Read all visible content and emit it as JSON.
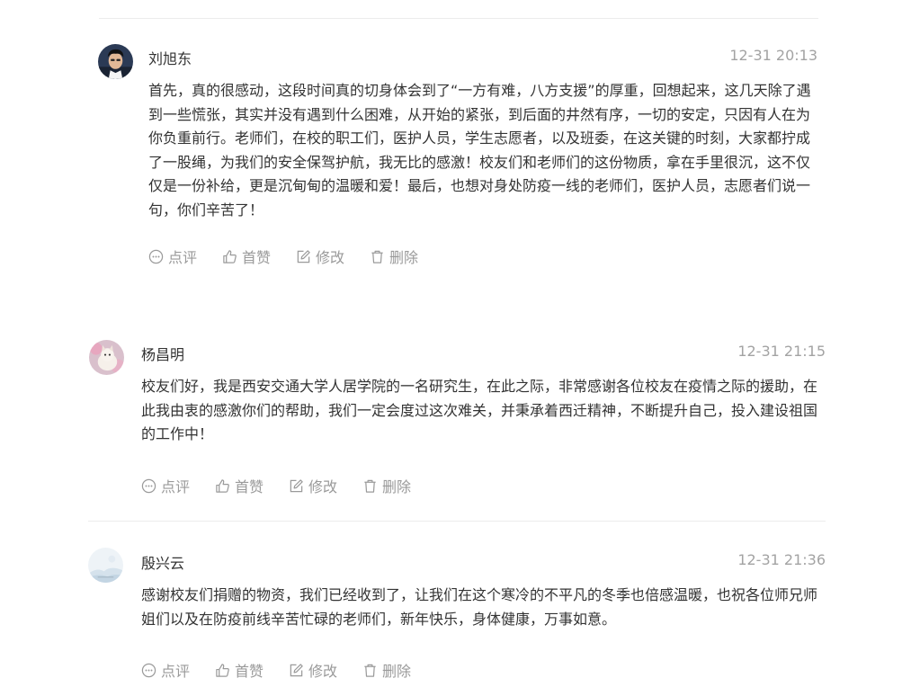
{
  "comments": [
    {
      "author": "刘旭东",
      "time": "12-31 20:13",
      "content": "首先，真的很感动，这段时间真的切身体会到了“一方有难，八方支援”的厚重，回想起来，这几天除了遇到一些慌张，其实并没有遇到什么困难，从开始的紧张，到后面的井然有序，一切的安定，只因有人在为你负重前行。老师们，在校的职工们，医护人员，学生志愿者，以及班委，在这关键的时刻，大家都拧成了一股绳，为我们的安全保驾护航，我无比的感激！校友们和老师们的这份物质，拿在手里很沉，这不仅仅是一份补给，更是沉甸甸的温暖和爱！最后，也想对身处防疫一线的老师们，医护人员，志愿者们说一句，你们辛苦了！",
      "avatar_icon": "avatar-man-icon",
      "actions": {
        "comment": "点评",
        "like": "首赞",
        "edit": "修改",
        "delete": "删除"
      }
    },
    {
      "author": "杨昌明",
      "time": "12-31 21:15",
      "content": "校友们好，我是西安交通大学人居学院的一名研究生，在此之际，非常感谢各位校友在疫情之际的援助，在此我由衷的感激你们的帮助，我们一定会度过这次难关，并秉承着西迁精神，不断提升自己，投入建设祖国的工作中！",
      "avatar_icon": "avatar-cat-icon",
      "actions": {
        "comment": "点评",
        "like": "首赞",
        "edit": "修改",
        "delete": "删除"
      }
    },
    {
      "author": "殷兴云",
      "time": "12-31 21:36",
      "content": "感谢校友们捐赠的物资，我们已经收到了，让我们在这个寒冷的不平凡的冬季也倍感温暖，也祝各位师兄师姐们以及在防疫前线辛苦忙碌的老师们，新年快乐，身体健康，万事如意。",
      "avatar_icon": "avatar-landscape-icon",
      "actions": {
        "comment": "点评",
        "like": "首赞",
        "edit": "修改",
        "delete": "删除"
      }
    }
  ],
  "colors": {
    "text": "#333333",
    "muted": "#9a9a9a",
    "divider": "#ececec"
  }
}
